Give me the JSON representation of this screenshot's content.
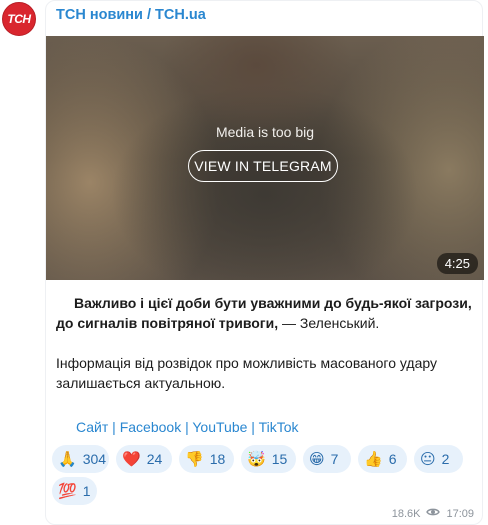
{
  "channel": {
    "avatar_text": "TCH",
    "name": "ТСН новини / TCH.ua"
  },
  "media": {
    "notice": "Media is too big",
    "button_label": "VIEW IN TELEGRAM",
    "duration": "4:25"
  },
  "message": {
    "bold": "Важливо і цієї доби бути уважними до будь-якої загрози, до сигналів повітряної тривоги,",
    "quote_author": " — Зеленський.",
    "paragraph2": "Інформація від розвідок про можливість масованого удару залишається актуальною."
  },
  "links": {
    "site": "Сайт",
    "facebook": "Facebook",
    "youtube": "YouTube",
    "tiktok": "TikTok",
    "separator": " | "
  },
  "reactions": [
    {
      "emoji": "🙏",
      "count": "304"
    },
    {
      "emoji": "❤️",
      "count": "24"
    },
    {
      "emoji": "👎",
      "count": "18"
    },
    {
      "emoji": "🤯",
      "count": "15"
    },
    {
      "emoji": "😁",
      "count": "7"
    },
    {
      "emoji": "👍",
      "count": "6"
    },
    {
      "emoji": "😐",
      "count": "2"
    },
    {
      "emoji": "💯",
      "count": "1"
    }
  ],
  "meta": {
    "views": "18.6K",
    "time": "17:09"
  }
}
